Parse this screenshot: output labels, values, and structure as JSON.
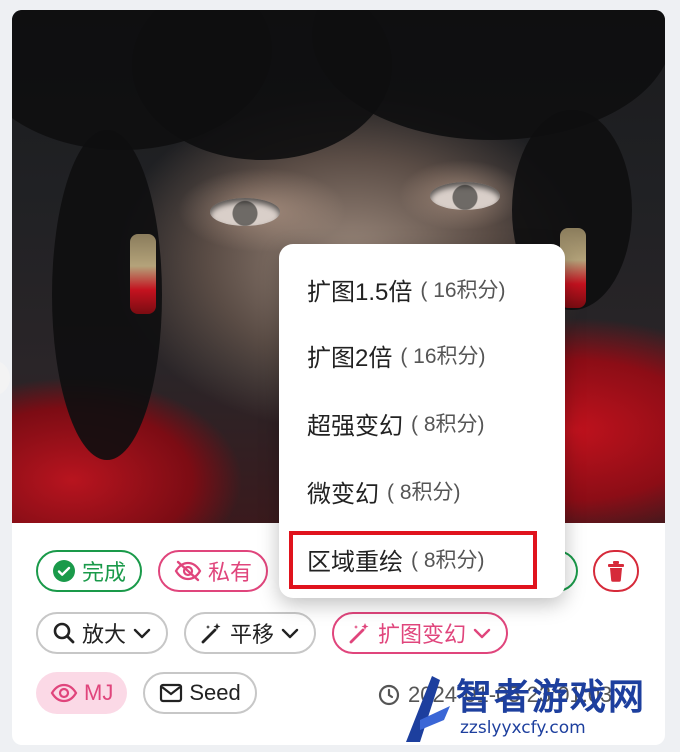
{
  "status": {
    "done": "完成",
    "private": "私有"
  },
  "actions": {
    "upscale": "放大",
    "pan": "平移",
    "expand_vary": "扩图变幻"
  },
  "meta": {
    "model": "MJ",
    "seed": "Seed",
    "timestamp": "2024-01-05 23:01:03"
  },
  "menu": [
    {
      "label": "扩图1.5倍",
      "cost": "( 16积分)"
    },
    {
      "label": "扩图2倍",
      "cost": "( 16积分)"
    },
    {
      "label": "超强变幻",
      "cost": "( 8积分)"
    },
    {
      "label": "微变幻",
      "cost": "( 8积分)"
    },
    {
      "label": "区域重绘",
      "cost": "( 8积分)"
    }
  ],
  "watermark": {
    "brand": "智者游戏网",
    "url": "zzslyyxcfy.com"
  },
  "colors": {
    "success": "#1a9a4a",
    "accent": "#e0457c",
    "danger": "#d62a3a",
    "highlight": "#e0131d"
  }
}
